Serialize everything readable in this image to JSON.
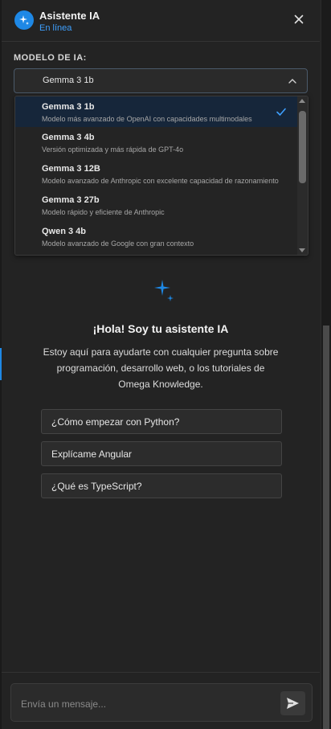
{
  "header": {
    "title": "Asistente IA",
    "status": "En línea"
  },
  "model": {
    "label": "MODELO DE IA:",
    "selected": "Gemma 3 1b",
    "options": [
      {
        "name": "Gemma 3 1b",
        "description": "Modelo más avanzado de OpenAI con capacidades multimodales",
        "selected": true
      },
      {
        "name": "Gemma 3 4b",
        "description": "Versión optimizada y más rápida de GPT-4o",
        "selected": false
      },
      {
        "name": "Gemma 3 12B",
        "description": "Modelo avanzado de Anthropic con excelente capacidad de razonamiento",
        "selected": false
      },
      {
        "name": "Gemma 3 27b",
        "description": "Modelo rápido y eficiente de Anthropic",
        "selected": false
      },
      {
        "name": "Qwen 3 4b",
        "description": "Modelo avanzado de Google con gran contexto",
        "selected": false
      }
    ]
  },
  "welcome": {
    "title": "¡Hola! Soy tu asistente IA",
    "text": "Estoy aquí para ayudarte con cualquier pregunta sobre programación, desarrollo web, o los tutoriales de Omega Knowledge.",
    "suggestions": [
      "¿Cómo empezar con Python?",
      "Explícame Angular",
      "¿Qué es TypeScript?"
    ]
  },
  "composer": {
    "placeholder": "Envía un mensaje..."
  },
  "icons": {
    "avatar": "sparkle-icon",
    "close": "close-icon",
    "chevron": "chevron-up-icon",
    "check": "check-icon",
    "send": "send-icon"
  },
  "colors": {
    "accent": "#1e88e5",
    "status": "#3ea0ff",
    "background": "#232323"
  }
}
